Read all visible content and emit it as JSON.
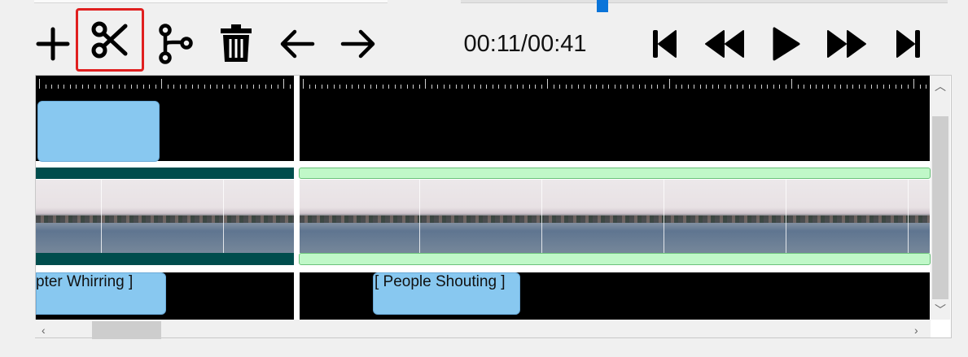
{
  "toolbar": {
    "buttons": [
      {
        "name": "add",
        "icon": "plus-icon"
      },
      {
        "name": "cut",
        "icon": "scissors-icon",
        "highlighted": true
      },
      {
        "name": "branch",
        "icon": "branch-icon"
      },
      {
        "name": "delete",
        "icon": "trash-icon"
      },
      {
        "name": "undo",
        "icon": "arrow-left-icon"
      },
      {
        "name": "redo",
        "icon": "arrow-right-icon"
      }
    ],
    "timecode": "00:11/00:41",
    "playback": [
      {
        "name": "skip-to-start",
        "icon": "skip-start-icon"
      },
      {
        "name": "rewind",
        "icon": "rewind-icon"
      },
      {
        "name": "play",
        "icon": "play-icon"
      },
      {
        "name": "fast-forward",
        "icon": "fast-forward-icon"
      },
      {
        "name": "skip-to-end",
        "icon": "skip-end-icon"
      }
    ]
  },
  "timeline": {
    "caption_clips": [
      {
        "text": "pter Whirring ]"
      },
      {
        "text": "[ People Shouting ]"
      }
    ]
  },
  "colors": {
    "highlight": "#e02020",
    "clip_blue": "#88c8f0",
    "video_bar_dark": "#004d4d",
    "video_bar_light": "#c0f8c8",
    "progress": "#0a74d9"
  }
}
